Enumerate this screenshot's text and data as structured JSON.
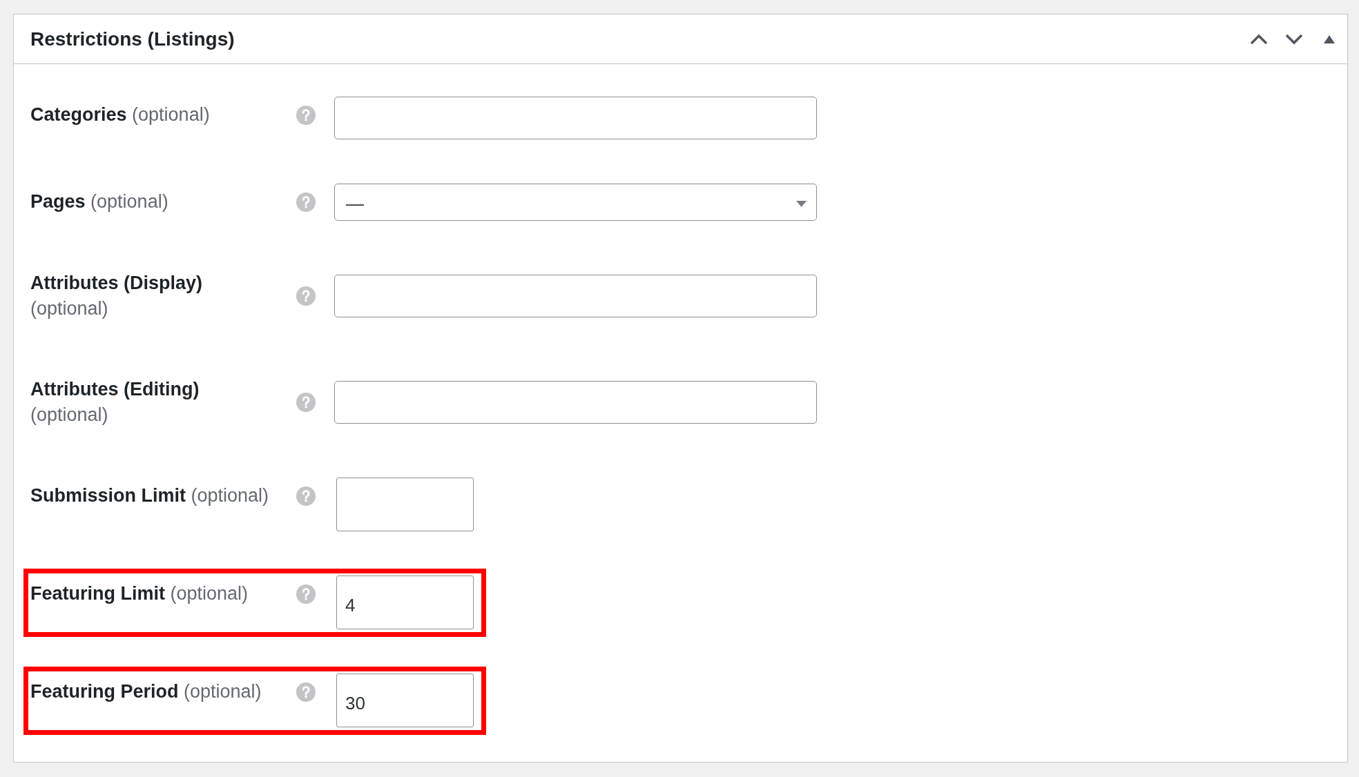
{
  "panel": {
    "title": "Restrictions (Listings)",
    "controls": [
      {
        "kind": "up"
      },
      {
        "kind": "down"
      },
      {
        "kind": "toggle",
        "expanded": true
      }
    ]
  },
  "fields": [
    {
      "label": "Categories",
      "hint": "(optional)",
      "kind": "text",
      "highlighted": false
    },
    {
      "label": "Pages",
      "hint": "(optional)",
      "kind": "select",
      "value": "—",
      "highlighted": false
    },
    {
      "label": "Attributes (Display)",
      "hint": "(optional)",
      "kind": "text",
      "highlighted": false
    },
    {
      "label": "Attributes (Editing)",
      "hint": "(optional)",
      "kind": "text",
      "highlighted": false
    },
    {
      "label": "Submission Limit",
      "hint": "(optional)",
      "kind": "number",
      "highlighted": false
    },
    {
      "label": "Featuring Limit",
      "hint": "(optional)",
      "kind": "number",
      "value": "4",
      "highlighted": true
    },
    {
      "label": "Featuring Period",
      "hint": "(optional)",
      "kind": "number",
      "value": "30",
      "highlighted": true
    }
  ]
}
